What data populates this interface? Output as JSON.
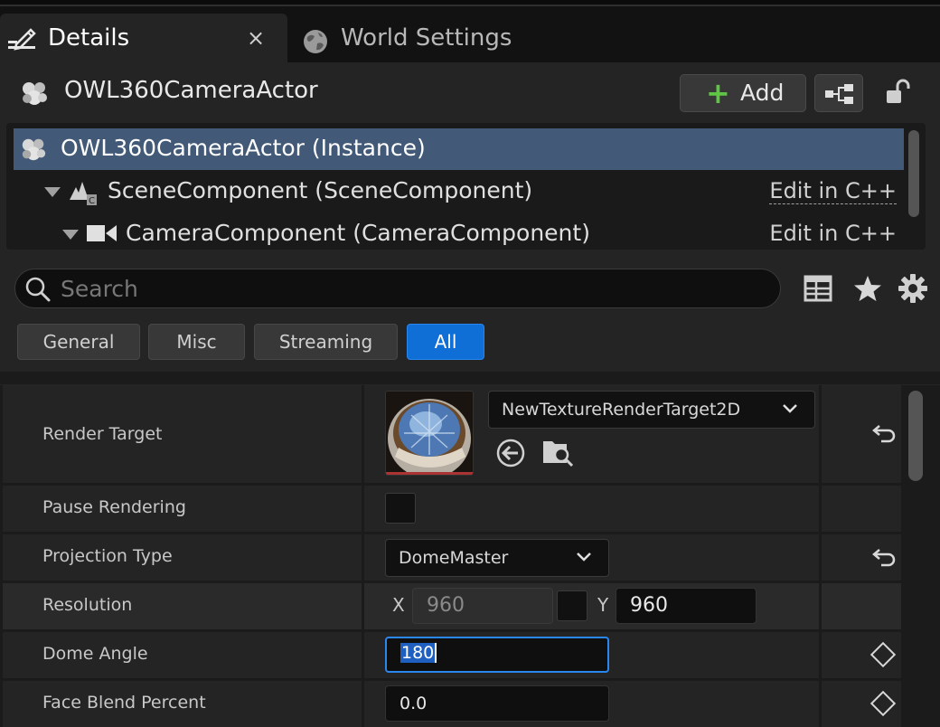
{
  "tabs": {
    "details_label": "Details",
    "details_close": "×",
    "world_settings_label": "World Settings"
  },
  "actor": {
    "name": "OWL360CameraActor",
    "add_label": "Add",
    "add_plus": "+"
  },
  "component_tree": {
    "rows": [
      {
        "label": "OWL360CameraActor (Instance)",
        "edit": ""
      },
      {
        "label": "SceneComponent (SceneComponent)",
        "edit": "Edit in C++"
      },
      {
        "label": "CameraComponent (CameraComponent)",
        "edit": "Edit in C++"
      }
    ]
  },
  "search": {
    "placeholder": "Search"
  },
  "filters": [
    {
      "label": "General",
      "active": false
    },
    {
      "label": "Misc",
      "active": false
    },
    {
      "label": "Streaming",
      "active": false
    },
    {
      "label": "All",
      "active": true
    }
  ],
  "properties": {
    "render_target": {
      "label": "Render Target",
      "value": "NewTextureRenderTarget2D"
    },
    "pause_rendering": {
      "label": "Pause Rendering",
      "checked": false
    },
    "projection_type": {
      "label": "Projection Type",
      "value": "DomeMaster"
    },
    "resolution": {
      "label": "Resolution",
      "x_label": "X",
      "x_value": "960",
      "y_label": "Y",
      "y_value": "960"
    },
    "dome_angle": {
      "label": "Dome Angle",
      "value": "180"
    },
    "face_blend_percent": {
      "label": "Face Blend Percent",
      "value": "0.0"
    }
  },
  "colors": {
    "accent": "#0f6fd6",
    "selection": "#425a78",
    "add_plus": "#5fc544",
    "panel": "#242424"
  },
  "icons": [
    "details-pencil-icon",
    "close-icon",
    "world-globe-icon",
    "actor-icon",
    "plus-icon",
    "blueprint-icon",
    "unlock-icon",
    "scene-component-icon",
    "camera-icon",
    "search-icon",
    "table-view-icon",
    "favorite-star-icon",
    "settings-gear-icon",
    "chevron-down-icon",
    "use-selected-arrow-icon",
    "browse-folder-icon",
    "reset-arrow-icon",
    "keyframe-diamond-icon"
  ]
}
